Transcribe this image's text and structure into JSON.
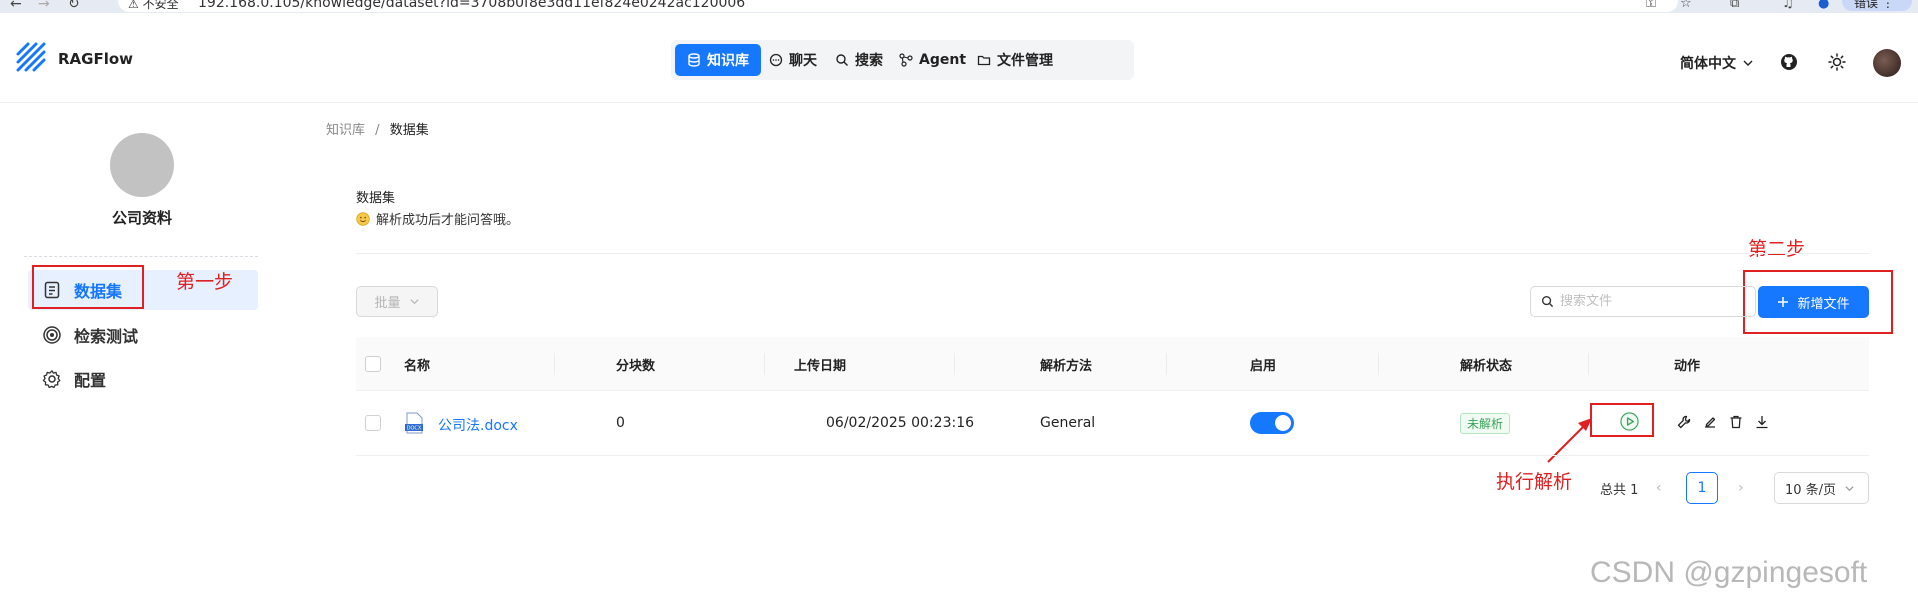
{
  "browser": {
    "security_label": "不安全",
    "url": "192.168.0.105/knowledge/dataset?id=3708b0f8e3dd11ef824e0242ac120006",
    "profile_error_label": "错误"
  },
  "app": {
    "brand": "RAGFlow",
    "nav": [
      {
        "label": "知识库",
        "icon": "database-icon",
        "active": true
      },
      {
        "label": "聊天",
        "icon": "chat-icon",
        "active": false
      },
      {
        "label": "搜索",
        "icon": "search-icon",
        "active": false
      },
      {
        "label": "Agent",
        "icon": "agent-graph-icon",
        "active": false
      },
      {
        "label": "文件管理",
        "icon": "folder-icon",
        "active": false
      }
    ],
    "language": "简体中文"
  },
  "sidebar": {
    "kb_name": "公司资料",
    "items": [
      {
        "label": "数据集",
        "icon": "document-icon",
        "active": true
      },
      {
        "label": "检索测试",
        "icon": "target-icon",
        "active": false
      },
      {
        "label": "配置",
        "icon": "gear-icon",
        "active": false
      }
    ]
  },
  "breadcrumb": {
    "root": "知识库",
    "separator": "/",
    "current": "数据集"
  },
  "section": {
    "title": "数据集",
    "tip": "解析成功后才能问答哦。"
  },
  "toolbar": {
    "batch_label": "批量",
    "search_placeholder": "搜索文件",
    "add_label": "新增文件"
  },
  "table": {
    "columns": [
      "名称",
      "分块数",
      "上传日期",
      "解析方法",
      "启用",
      "解析状态",
      "动作"
    ],
    "rows": [
      {
        "name": "公司法.docx",
        "chunks": "0",
        "upload_date": "06/02/2025 00:23:16",
        "parser": "General",
        "enabled": true,
        "status": "未解析"
      }
    ]
  },
  "pagination": {
    "total_label": "总共 1",
    "current_page": "1",
    "page_size": "10 条/页"
  },
  "annotations": {
    "step1": "第一步",
    "step2": "第二步",
    "parse": "执行解析"
  },
  "watermark": "CSDN @gzpingesoft",
  "colors": {
    "accent": "#1677ff",
    "annotation": "#e02020",
    "status_green": "#3aa35a"
  }
}
